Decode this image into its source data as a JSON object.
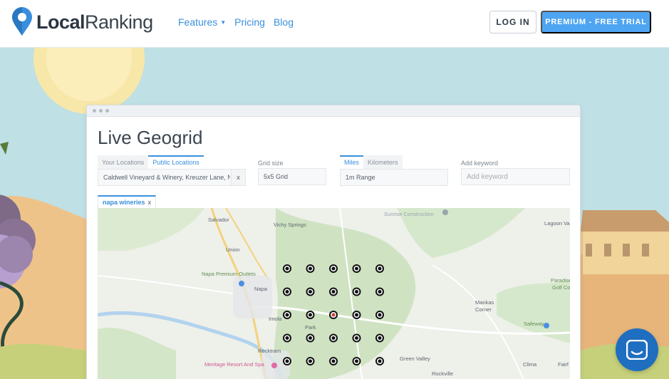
{
  "brand": {
    "name_bold": "Local",
    "name_light": "Ranking",
    "pin_color": "#3a8fdc"
  },
  "nav": {
    "items": [
      {
        "label": "Features",
        "has_dropdown": true,
        "icon": "chevron-down-icon"
      },
      {
        "label": "Pricing",
        "has_dropdown": false
      },
      {
        "label": "Blog",
        "has_dropdown": false
      }
    ]
  },
  "header": {
    "login_label": "LOG IN",
    "premium_label": "PREMIUM - FREE TRIAL"
  },
  "geogrid": {
    "title": "Live Geogrid",
    "location_tabs": [
      "Your Locations",
      "Public Locations"
    ],
    "active_location_tab": "Public Locations",
    "location_value": "Caldwell Vineyard & Winery, Kreuzer Lane, Na",
    "location_clear": "x",
    "grid_size_label": "Grid size",
    "grid_size_value": "5x5 Grid",
    "unit_tabs": [
      "Miles",
      "Kilometers"
    ],
    "active_unit_tab": "Miles",
    "range_value": "1m Range",
    "keyword_label": "Add keyword",
    "keyword_placeholder": "Add keyword",
    "keyword_chip": "napa wineries",
    "keyword_chip_remove": "x"
  },
  "map": {
    "grid_rows": 5,
    "grid_cols": 5,
    "highlight_cell": [
      2,
      2
    ],
    "labels": [
      {
        "text": "Salvador"
      },
      {
        "text": "Vichy Springs"
      },
      {
        "text": "Sunrise Construction"
      },
      {
        "text": "Lagoon Va"
      },
      {
        "text": "Union"
      },
      {
        "text": "Napa Premium Outlets"
      },
      {
        "text": "Napa"
      },
      {
        "text": "Imola"
      },
      {
        "text": "Park"
      },
      {
        "text": "Mankas"
      },
      {
        "text": "Corner"
      },
      {
        "text": "Paradise Va"
      },
      {
        "text": "Golf Co"
      },
      {
        "text": "Safeway"
      },
      {
        "text": "Rocktram"
      },
      {
        "text": "Meritage Resort And Spa"
      },
      {
        "text": "Green Valley"
      },
      {
        "text": "Clima"
      },
      {
        "text": "Fairf"
      },
      {
        "text": "Rockville"
      }
    ]
  },
  "colors": {
    "accent": "#3a8fdc",
    "premium": "#4ea5f2",
    "chat": "#1f6ec0",
    "marker_highlight": "#d93a3a"
  }
}
